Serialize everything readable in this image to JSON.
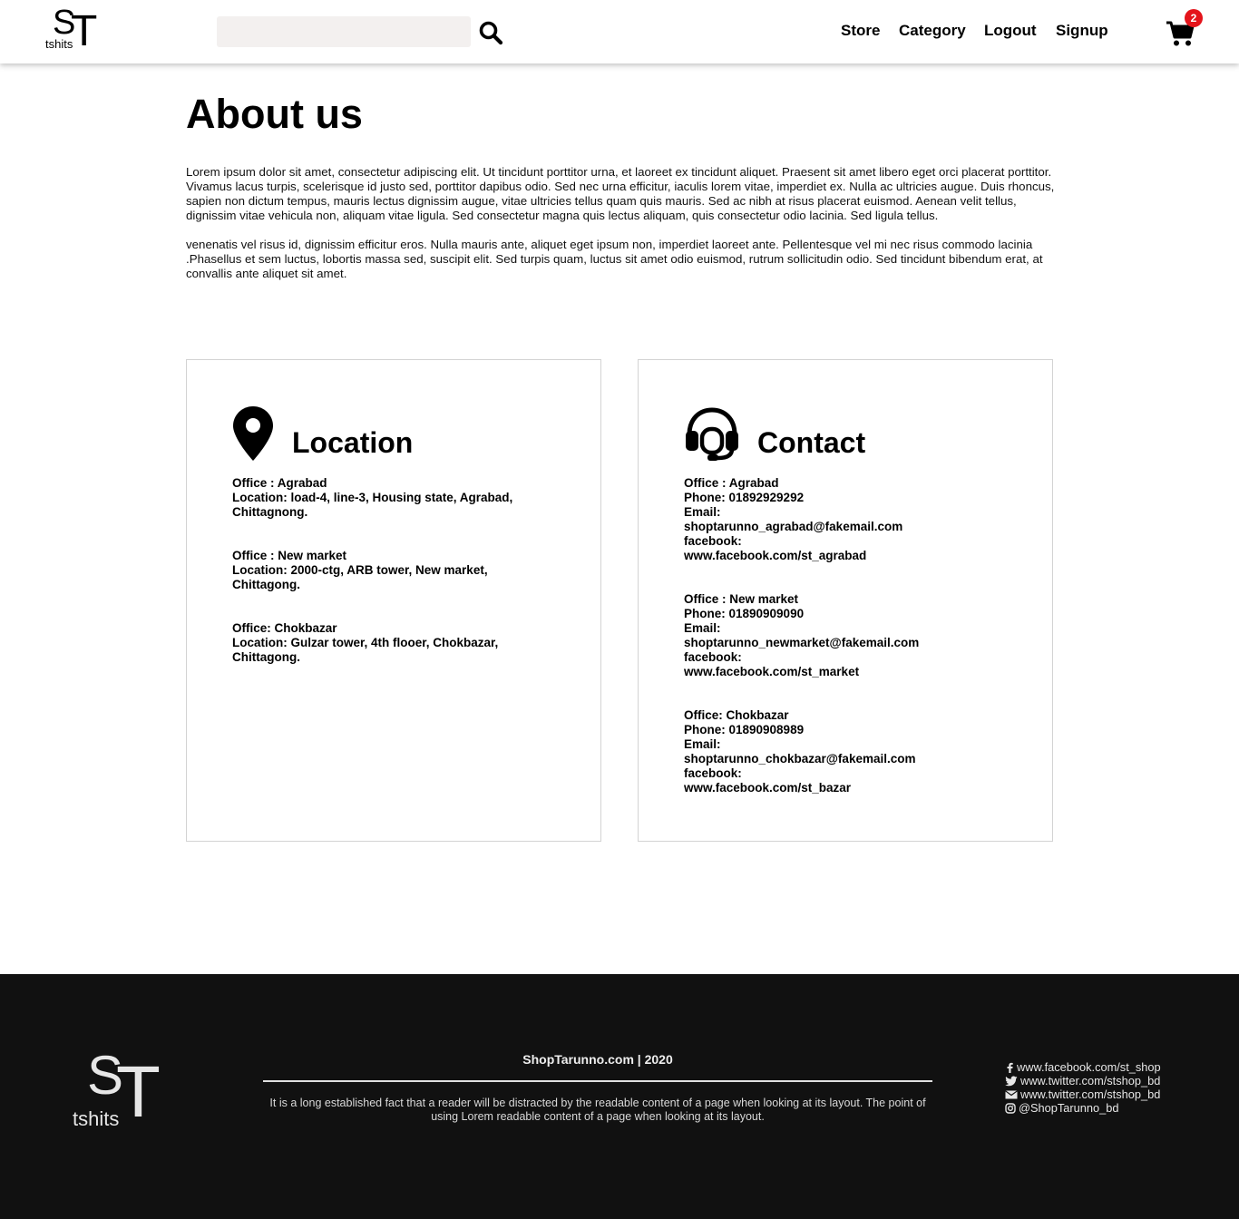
{
  "header": {
    "logo": {
      "letters_s": "S",
      "letters_t": "T",
      "tagline": "tshits"
    },
    "search": {
      "value": "",
      "placeholder": ""
    },
    "nav": [
      {
        "label": "Store"
      },
      {
        "label": "Category"
      },
      {
        "label": "Logout"
      },
      {
        "label": "Signup"
      }
    ],
    "cart": {
      "count": "2",
      "icon": "cart-icon"
    },
    "accent_color": "#e4141b"
  },
  "main": {
    "title": "About us",
    "paragraphs": [
      "Lorem ipsum dolor sit amet, consectetur adipiscing elit. Ut tincidunt porttitor urna, et laoreet ex tincidunt aliquet. Praesent sit amet libero eget orci placerat porttitor. Vivamus lacus turpis, scelerisque id justo sed, porttitor dapibus odio. Sed nec urna efficitur, iaculis lorem vitae, imperdiet ex. Nulla ac ultricies augue. Duis rhoncus, sapien non dictum tempus, mauris lectus dignissim augue, vitae ultricies tellus quam quis mauris. Sed ac nibh at risus placerat euismod. Aenean velit tellus, dignissim vitae vehicula non, aliquam vitae ligula. Sed consectetur magna quis lectus aliquam, quis consectetur odio lacinia. Sed ligula tellus.",
      "venenatis vel risus id, dignissim efficitur eros. Nulla mauris ante, aliquet eget ipsum non, imperdiet laoreet ante. Pellentesque vel mi nec risus commodo lacinia .Phasellus et sem luctus, lobortis massa sed, suscipit elit. Sed turpis quam, luctus sit amet odio euismod, rutrum sollicitudin odio. Sed tincidunt bibendum erat, at convallis ante aliquet sit amet."
    ],
    "location": {
      "title": "Location",
      "icon": "map-pin-icon",
      "offices": [
        {
          "office": "Office : Agrabad",
          "location": "Location: load-4, line-3, Housing state, Agrabad, Chittagnong."
        },
        {
          "office": "Office : New market",
          "location": "Location: 2000-ctg, ARB tower, New market, Chittagong."
        },
        {
          "office": "Office: Chokbazar",
          "location": "Location: Gulzar tower, 4th flooer, Chokbazar, Chittagong."
        }
      ]
    },
    "contact": {
      "title": "Contact",
      "icon": "headset-icon",
      "offices": [
        {
          "office": "Office : Agrabad",
          "phone": "Phone: 01892929292",
          "email_label": "Email:",
          "email": "shoptarunno_agrabad@fakemail.com",
          "facebook_label": "facebook:",
          "facebook": "www.facebook.com/st_agrabad"
        },
        {
          "office": "Office : New market",
          "phone": "Phone: 01890909090",
          "email_label": "Email:",
          "email": "shoptarunno_newmarket@fakemail.com",
          "facebook_label": "facebook:",
          "facebook": "www.facebook.com/st_market"
        },
        {
          "office": "Office: Chokbazar",
          "phone": "Phone: 01890908989",
          "email_label": "Email:",
          "email": "shoptarunno_chokbazar@fakemail.com",
          "facebook_label": "facebook:",
          "facebook": "www.facebook.com/st_bazar"
        }
      ]
    }
  },
  "footer": {
    "logo": {
      "letters_s": "S",
      "letters_t": "T",
      "tagline": "tshits"
    },
    "brand": "ShopTarunno.com | 2020",
    "description": "It is a long established fact that a reader will be distracted by the readable content of a page when looking at its layout. The point of using Lorem readable content of a page when looking at its layout.",
    "social": [
      {
        "icon": "facebook-icon",
        "label": "www.facebook.com/st_shop"
      },
      {
        "icon": "twitter-icon",
        "label": "www.twitter.com/stshop_bd"
      },
      {
        "icon": "envelope-icon",
        "label": "www.twitter.com/stshop_bd"
      },
      {
        "icon": "instagram-icon",
        "label": "@ShopTarunno_bd"
      }
    ],
    "background_color": "#111111"
  }
}
